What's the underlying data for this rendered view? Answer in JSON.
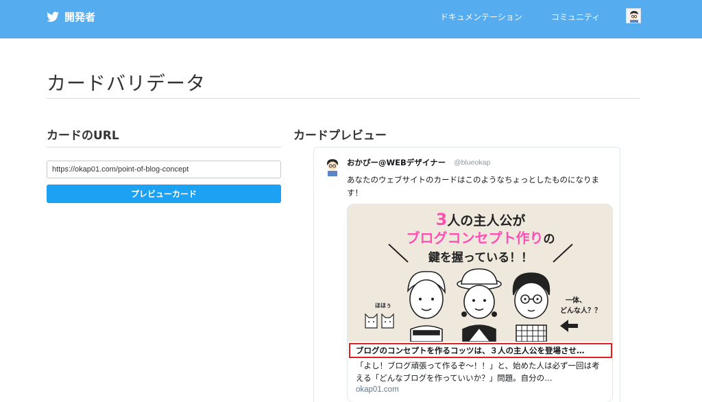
{
  "header": {
    "brand": "開発者",
    "nav": {
      "docs": "ドキュメンテーション",
      "community": "コミュニティ"
    }
  },
  "page": {
    "title": "カードバリデータ"
  },
  "url_section": {
    "heading": "カードのURL",
    "url_value": "https://okap01.com/point-of-blog-concept",
    "button_label": "プレビューカード"
  },
  "preview_section": {
    "heading": "カードプレビュー",
    "tweet": {
      "name": "おかぴー@WEBデザイナー",
      "handle": "@blueokap",
      "text": "あなたのウェブサイトのカードはこのようなちょっとしたものになります！",
      "card": {
        "image": {
          "line1_number": "3",
          "line1_rest": "人の主人公が",
          "line2": "ブログコンセプト作り",
          "line2_suffix": "の",
          "line3": "鍵を握っている！！",
          "cat_caption": "ほほぅ",
          "right_caption_1": "一体、",
          "right_caption_2": "どんな人？？"
        },
        "title": "ブログのコンセプトを作るコッツは、３人の主人公を登場させ…",
        "description": "「よし！ブログ頑張って作るぞ〜！！」と、始めた人は必ず一回は考える「どんなブログを作っていいか？」問題。自分の…",
        "domain": "okap01.com"
      }
    }
  },
  "colors": {
    "header_bg": "#55acee",
    "button_bg": "#1da1f2",
    "highlight_border": "#e0201f",
    "image_accent": "#ff4fb4"
  }
}
